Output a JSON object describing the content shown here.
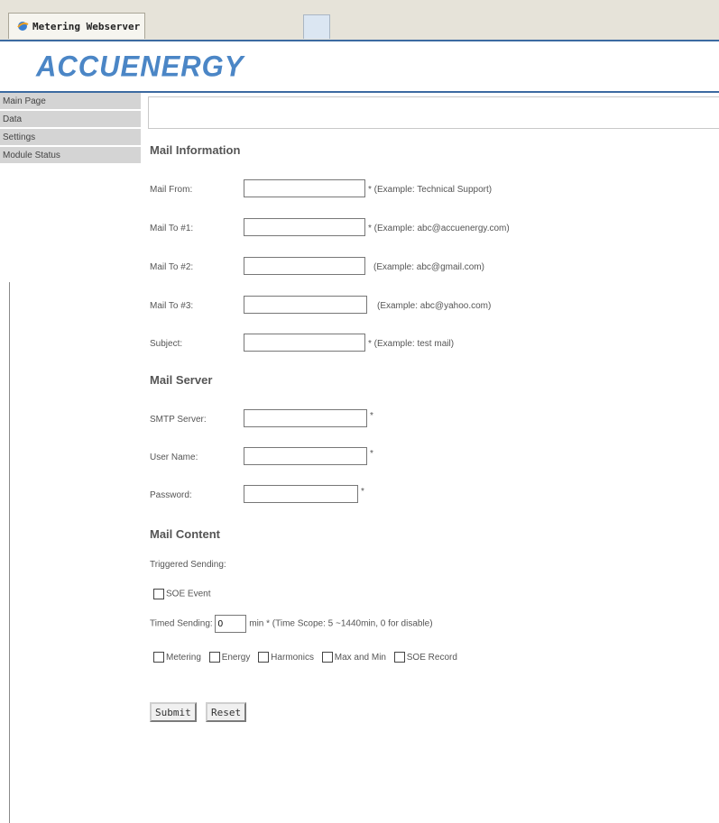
{
  "browser": {
    "tab_title": "Metering Webserver"
  },
  "header": {
    "logo_text": "ACCUENERGY"
  },
  "sidebar": {
    "items": [
      {
        "label": "Main Page"
      },
      {
        "label": "Data"
      },
      {
        "label": "Settings"
      },
      {
        "label": "Module Status"
      }
    ]
  },
  "mail_info": {
    "title": "Mail Information",
    "from": {
      "label": "Mail From:",
      "value": "",
      "hint": "* (Example: Technical Support)"
    },
    "to1": {
      "label": "Mail To #1:",
      "value": "",
      "hint": "* (Example: abc@accuenergy.com)"
    },
    "to2": {
      "label": "Mail To #2:",
      "value": "",
      "hint": "(Example: abc@gmail.com)"
    },
    "to3": {
      "label": "Mail To #3:",
      "value": "",
      "hint": "(Example: abc@yahoo.com)"
    },
    "subject": {
      "label": "Subject:",
      "value": "",
      "hint": "* (Example: test mail)"
    }
  },
  "mail_server": {
    "title": "Mail Server",
    "smtp": {
      "label": "SMTP Server:",
      "value": "",
      "hint": "*"
    },
    "user": {
      "label": "User Name:",
      "value": "",
      "hint": "*"
    },
    "password": {
      "label": "Password:",
      "value": "",
      "hint": "*"
    }
  },
  "mail_content": {
    "title": "Mail Content",
    "triggered_label": "Triggered Sending:",
    "soe_event": "SOE Event",
    "timed_label": "Timed Sending:",
    "timed_value": "0",
    "timed_hint": "min * (Time Scope: 5 ~1440min, 0 for disable)",
    "options": [
      "Metering",
      "Energy",
      "Harmonics",
      "Max and Min",
      "SOE Record"
    ]
  },
  "buttons": {
    "submit": "Submit",
    "reset": "Reset"
  },
  "colors": {
    "logo": "#4b86c6",
    "accent_line": "#3c6aa1",
    "sidebar_bg": "#d4d4d4"
  }
}
